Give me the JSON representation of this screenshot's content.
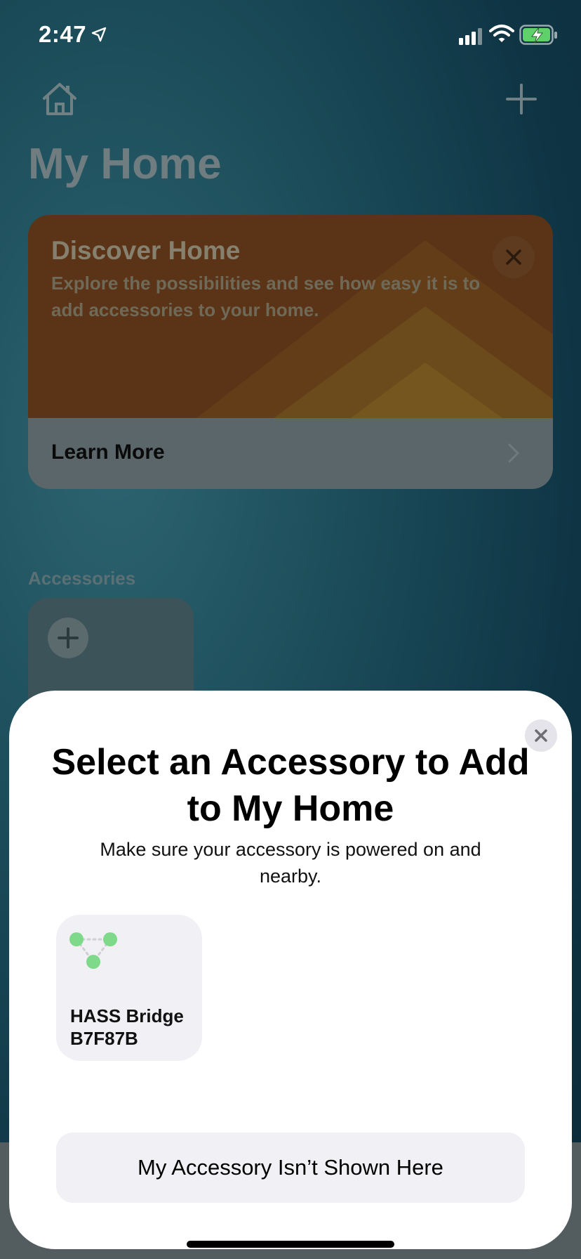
{
  "status_bar": {
    "time": "2:47"
  },
  "header": {
    "title": "My Home"
  },
  "discover_card": {
    "title": "Discover Home",
    "description": "Explore the possibilities and see how easy it is to add accessories to your home.",
    "learn_more": "Learn More"
  },
  "accessories": {
    "section_label": "Accessories"
  },
  "sheet": {
    "title": "Select an Accessory to Add to My Home",
    "subtitle": "Make sure your accessory is powered on and nearby.",
    "accessory_items": [
      {
        "name": "HASS Bridge B7F87B",
        "icon": "bridge-icon"
      }
    ],
    "not_shown_button": "My Accessory Isn’t Shown Here"
  },
  "colors": {
    "accent_green": "#7ed98a",
    "discover_orange": "#5b3316",
    "sheet_bg": "#ffffff"
  }
}
